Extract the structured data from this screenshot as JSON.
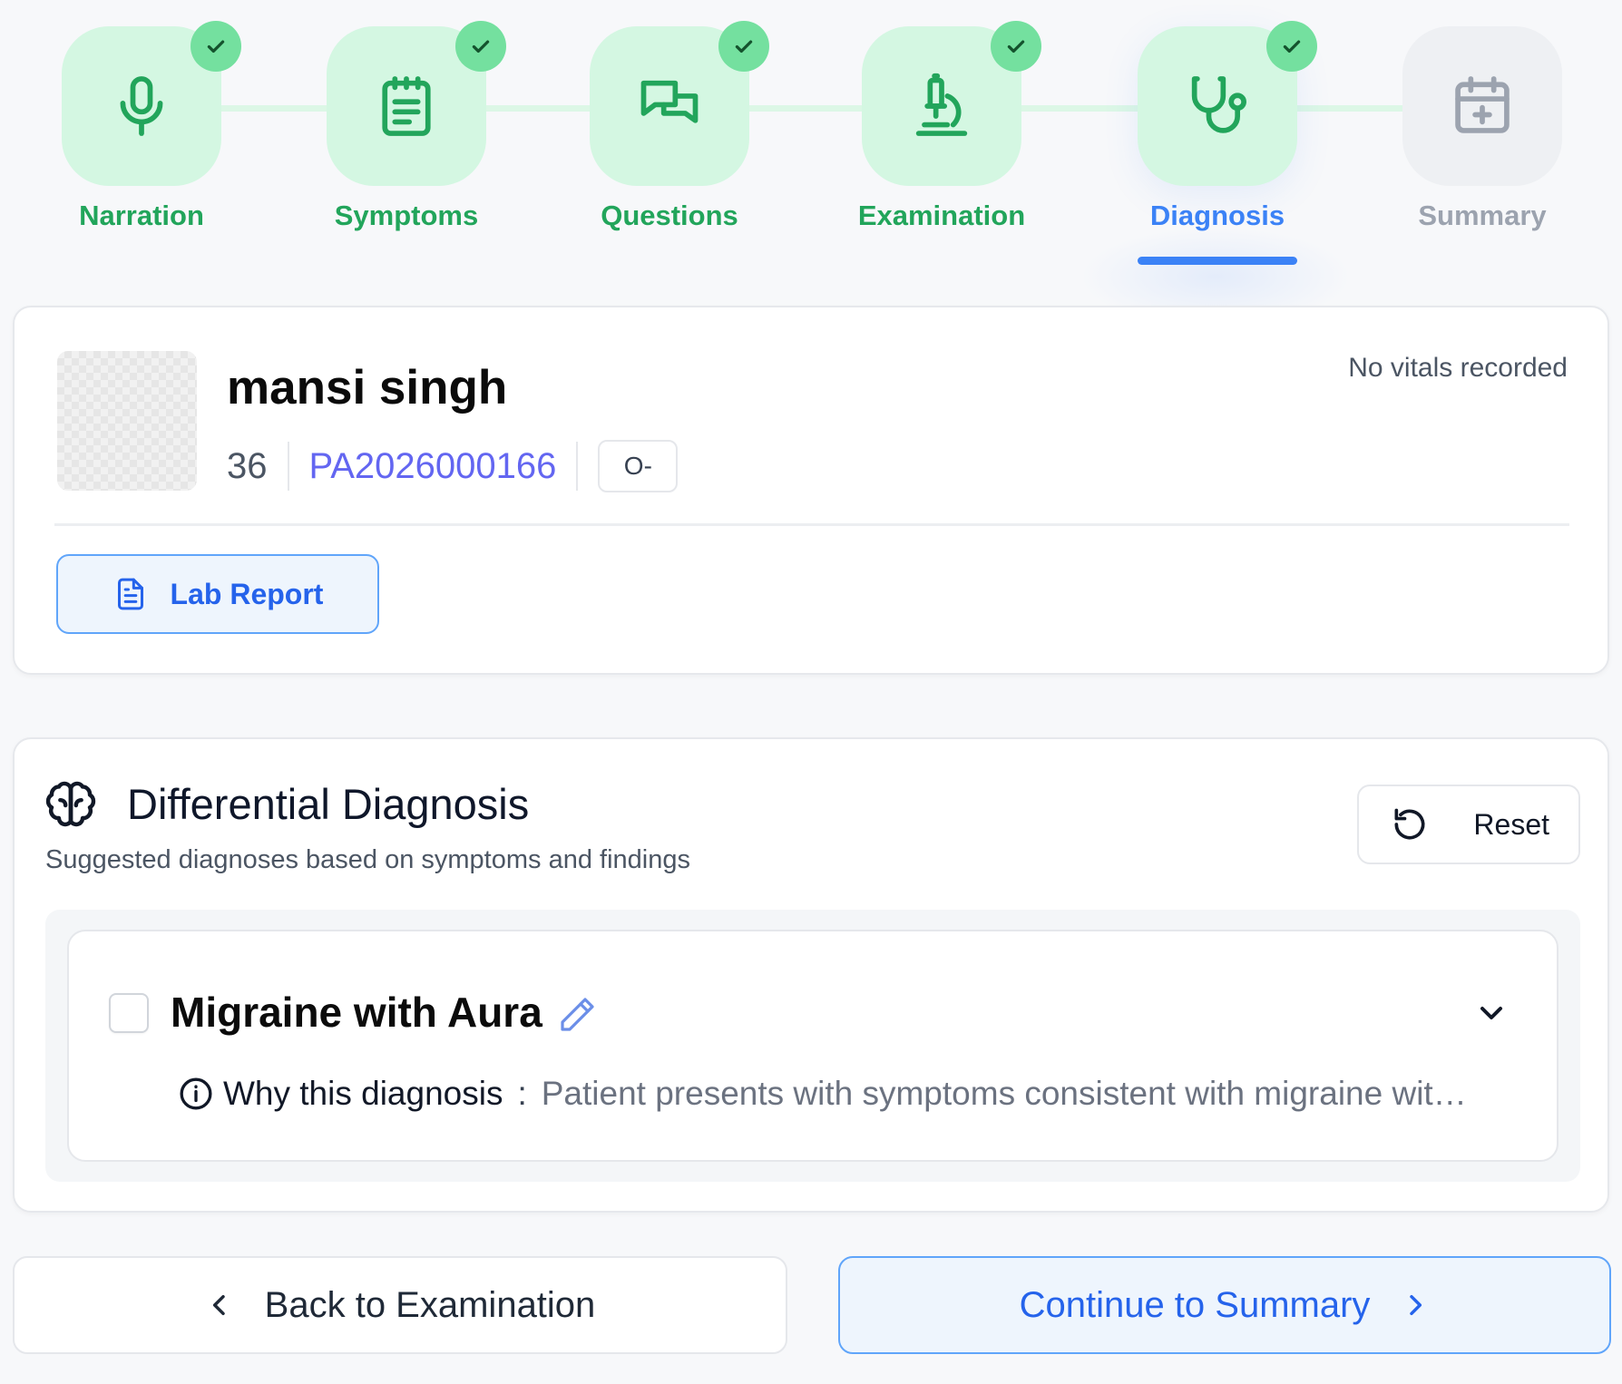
{
  "stepper": {
    "steps": [
      {
        "label": "Narration",
        "icon": "microphone-icon",
        "status": "completed"
      },
      {
        "label": "Symptoms",
        "icon": "clipboard-icon",
        "status": "completed"
      },
      {
        "label": "Questions",
        "icon": "chat-bubbles-icon",
        "status": "completed"
      },
      {
        "label": "Examination",
        "icon": "microscope-icon",
        "status": "completed"
      },
      {
        "label": "Diagnosis",
        "icon": "stethoscope-icon",
        "status": "active"
      },
      {
        "label": "Summary",
        "icon": "calendar-plus-icon",
        "status": "pending"
      }
    ]
  },
  "patient": {
    "name": "mansi singh",
    "age": "36",
    "patient_id": "PA2026000166",
    "blood_group": "O-",
    "vitals_status": "No vitals recorded",
    "lab_report_label": "Lab Report"
  },
  "differential": {
    "title": "Differential Diagnosis",
    "subtitle": "Suggested diagnoses based on symptoms and findings",
    "reset_label": "Reset",
    "items": [
      {
        "name": "Migraine with Aura",
        "checked": false,
        "why_label": "Why this diagnosis",
        "why_colon": ":",
        "why_text": "Patient presents with symptoms consistent with migraine wit…"
      }
    ]
  },
  "footer": {
    "back_label": "Back to Examination",
    "continue_label": "Continue to Summary"
  },
  "colors": {
    "completed": "#22a55b",
    "completed_bg": "#d4f7e2",
    "check_badge": "#74e09f",
    "active": "#3b82f6",
    "pending": "#9ca3af",
    "patient_id": "#6366f1"
  }
}
